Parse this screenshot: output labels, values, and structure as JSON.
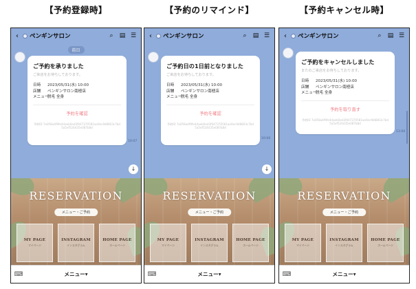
{
  "screens": [
    {
      "caption": "【予約登録時】",
      "header": {
        "title": "ペンギンサロン"
      },
      "date_chip": "前日",
      "card": {
        "title": "ご予約を承りました",
        "subtitle": "ご来店をお待ちしております。",
        "rows": [
          {
            "label": "日時",
            "value": "2023/05/31(水) 10:00"
          },
          {
            "label": "店舗",
            "value": "ペンギンサロン南極店"
          },
          {
            "label": "メニュー",
            "value": "脱毛 全身"
          }
        ],
        "action": "予約を確認",
        "hash": "予約ID 7a058a4f9fe44aeb0ed3f047370581ae0ec9d8803c7bd5a5ef524435e087b8d"
      },
      "time": "10:07",
      "rich_menu": {
        "title": "RESERVATION",
        "pill": "メニュー・ご予約",
        "tiles": [
          {
            "title": "MY PAGE",
            "sub": "マイページ"
          },
          {
            "title": "INSTAGRAM",
            "sub": "インスタグラム"
          },
          {
            "title": "HOME PAGE",
            "sub": "ホームページ"
          }
        ]
      },
      "menu_label": "メニュー▾"
    },
    {
      "caption": "【予約のリマインド】",
      "header": {
        "title": "ペンギンサロン"
      },
      "card": {
        "title": "ご予約日の1日前となりました",
        "subtitle": "ご来店をお待ちしております。",
        "rows": [
          {
            "label": "日時",
            "value": "2023/05/31(水) 10:00"
          },
          {
            "label": "店舗",
            "value": "ペンギンサロン南極店"
          },
          {
            "label": "メニュー",
            "value": "脱毛 全身"
          }
        ],
        "action": "予約を確認",
        "hash": "予約ID 7a058a4f9fe44aeb0ed3f047370581ae0ec9d8803c7bd5a5ef524435e087b8d"
      },
      "time": "10:00",
      "rich_menu": {
        "title": "RESERVATION",
        "pill": "メニュー・ご予約",
        "tiles": [
          {
            "title": "MY PAGE",
            "sub": "マイページ"
          },
          {
            "title": "INSTAGRAM",
            "sub": "インスタグラム"
          },
          {
            "title": "HOME PAGE",
            "sub": "ホームページ"
          }
        ]
      },
      "menu_label": "メニュー▾"
    },
    {
      "caption": "【予約キャンセル時】",
      "header": {
        "title": "ペンギンサロン"
      },
      "card": {
        "title": "ご予約をキャンセルしました",
        "subtitle": "またのご来店をお待ちしております。",
        "rows": [
          {
            "label": "日時",
            "value": "2023/05/31(水) 10:00"
          },
          {
            "label": "店舗",
            "value": "ペンギンサロン南極店"
          },
          {
            "label": "メニュー",
            "value": "脱毛 全身"
          }
        ],
        "action": "予約を取り直す",
        "hash": "予約ID 7a058a4f9fe44aeb0ed3f047370581ae0ec9d8803c7bd5a5ef524435e087b8d"
      },
      "time": "13:00",
      "rich_menu": {
        "title": "RESERVATION",
        "pill": "メニュー・ご予約",
        "tiles": [
          {
            "title": "MY PAGE",
            "sub": "マイページ"
          },
          {
            "title": "INSTAGRAM",
            "sub": "インスタグラム"
          },
          {
            "title": "HOME PAGE",
            "sub": "ホームページ"
          }
        ]
      },
      "menu_label": "メニュー▾"
    }
  ],
  "icons": {
    "back": "back-arrow-icon",
    "search": "search-icon",
    "notes": "note-icon",
    "menu": "hamburger-menu-icon",
    "scroll_down": "arrow-down-icon",
    "keyboard": "keyboard-icon"
  },
  "colors": {
    "chat_background": "#8facda",
    "action_link": "#f07b83",
    "card_background": "#ffffff"
  }
}
